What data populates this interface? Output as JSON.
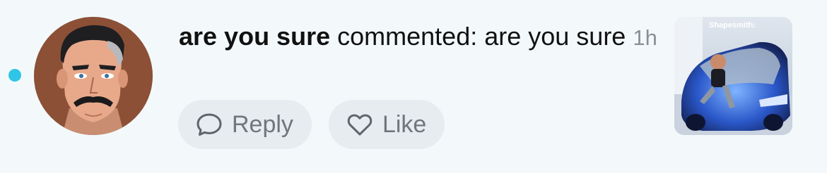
{
  "notification": {
    "username": "are you sure",
    "action_text": "commented: are you sure",
    "time": "1h",
    "unread": true
  },
  "actions": {
    "reply_label": "Reply",
    "like_label": "Like"
  },
  "thumbnail": {
    "caption": "Shapesmith:"
  },
  "icons": {
    "reply": "speech-bubble-icon",
    "like": "heart-outline-icon"
  },
  "colors": {
    "background": "#f3f9fb",
    "unread_dot": "#2ec5e6",
    "button_bg": "#e6ecef",
    "button_text": "#6f767d",
    "timestamp": "#8a8f95"
  }
}
